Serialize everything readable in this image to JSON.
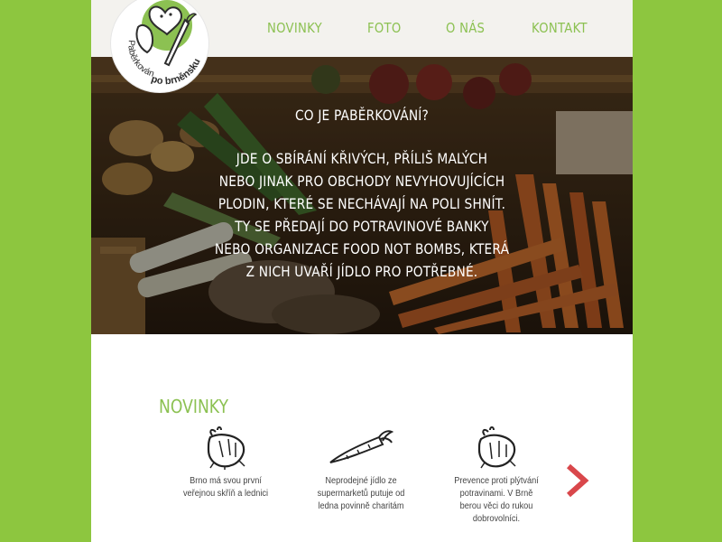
{
  "logo": {
    "line1": "Paběrkování",
    "line2": "po brněnsku"
  },
  "nav": {
    "items": [
      {
        "label": "NOVINKY"
      },
      {
        "label": "FOTO"
      },
      {
        "label": "O NÁS"
      },
      {
        "label": "KONTAKT"
      }
    ]
  },
  "hero": {
    "title": "CO JE PABĚRKOVÁNÍ?",
    "lines": [
      "JDE O SBÍRÁNÍ KŘIVÝCH, PŘÍLIŠ MALÝCH",
      "NEBO JINAK PRO OBCHODY NEVYHOVUJÍCÍCH",
      "PLODIN, KTERÉ SE NECHÁVAJÍ NA POLI SHNÍT.",
      "TY SE PŘEDAJÍ DO POTRAVINOVÉ BANKY",
      "NEBO ORGANIZACE FOOD NOT BOMBS, KTERÁ",
      "Z NICH UVAŘÍ JÍDLO PRO POTŘEBNÉ."
    ]
  },
  "news": {
    "heading": "NOVINKY",
    "items": [
      {
        "icon": "celeriac-icon",
        "lines": [
          "Brno má svou první",
          "veřejnou skříň a lednici"
        ]
      },
      {
        "icon": "carrot-icon",
        "lines": [
          "Neprodejné jídlo ze",
          "supermarketů putuje od",
          "ledna povinně charitám"
        ]
      },
      {
        "icon": "celeriac-icon",
        "lines": [
          "Prevence proti plýtvání",
          "potravinami. V Brně",
          "berou věci do rukou",
          "dobrovolníci."
        ]
      }
    ],
    "next_icon": "chevron-right-icon"
  },
  "colors": {
    "accent_green": "#8cc152",
    "background_green": "#8dc63f",
    "arrow_red": "#d9474b",
    "header_bg": "#f3f2ee"
  }
}
